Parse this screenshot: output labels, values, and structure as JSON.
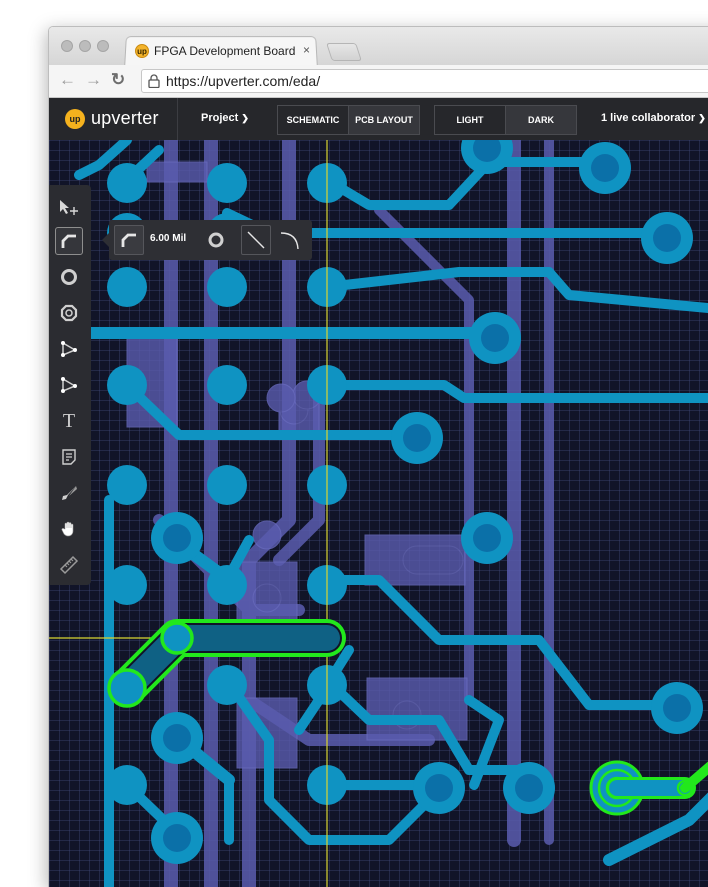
{
  "browser": {
    "tab_title": "FPGA Development Board",
    "tab_close": "×",
    "url": "https://upverter.com/eda/",
    "favicon": "upverter-logo-icon"
  },
  "app": {
    "logo_badge": "up",
    "logo_text": "upverter",
    "project_menu": "Project",
    "views": [
      "SCHEMATIC",
      "PCB LAYOUT"
    ],
    "active_view": "PCB LAYOUT",
    "themes": [
      "LIGHT",
      "DARK"
    ],
    "active_theme": "DARK",
    "collaborators": "1 live collaborator"
  },
  "tools": [
    {
      "name": "select-move-icon",
      "active": false
    },
    {
      "name": "route-trace-icon",
      "active": true
    },
    {
      "name": "via-icon",
      "active": false
    },
    {
      "name": "pad-icon",
      "active": false
    },
    {
      "name": "polygon-icon",
      "active": false
    },
    {
      "name": "polygon-cutout-icon",
      "active": false
    },
    {
      "name": "text-icon",
      "active": false,
      "glyph": "T"
    },
    {
      "name": "note-icon",
      "active": false
    },
    {
      "name": "knife-icon",
      "active": false
    },
    {
      "name": "pan-hand-icon",
      "active": false
    },
    {
      "name": "measure-ruler-icon",
      "active": false
    }
  ],
  "trace_popout": {
    "width_value": "6.00 Mil",
    "options": [
      "corner-trace-icon",
      "via-ring-icon",
      "straight-trace-icon",
      "arc-trace-icon"
    ]
  },
  "colors": {
    "pcb_background": "#111428",
    "copper_top": "#0f93c2",
    "pad_center": "#0b70a8",
    "copper_bottom": "#5a5cae",
    "selection": "#22e81c",
    "crosshair": "#d9d531",
    "toolbar_bg": "#26272b"
  }
}
